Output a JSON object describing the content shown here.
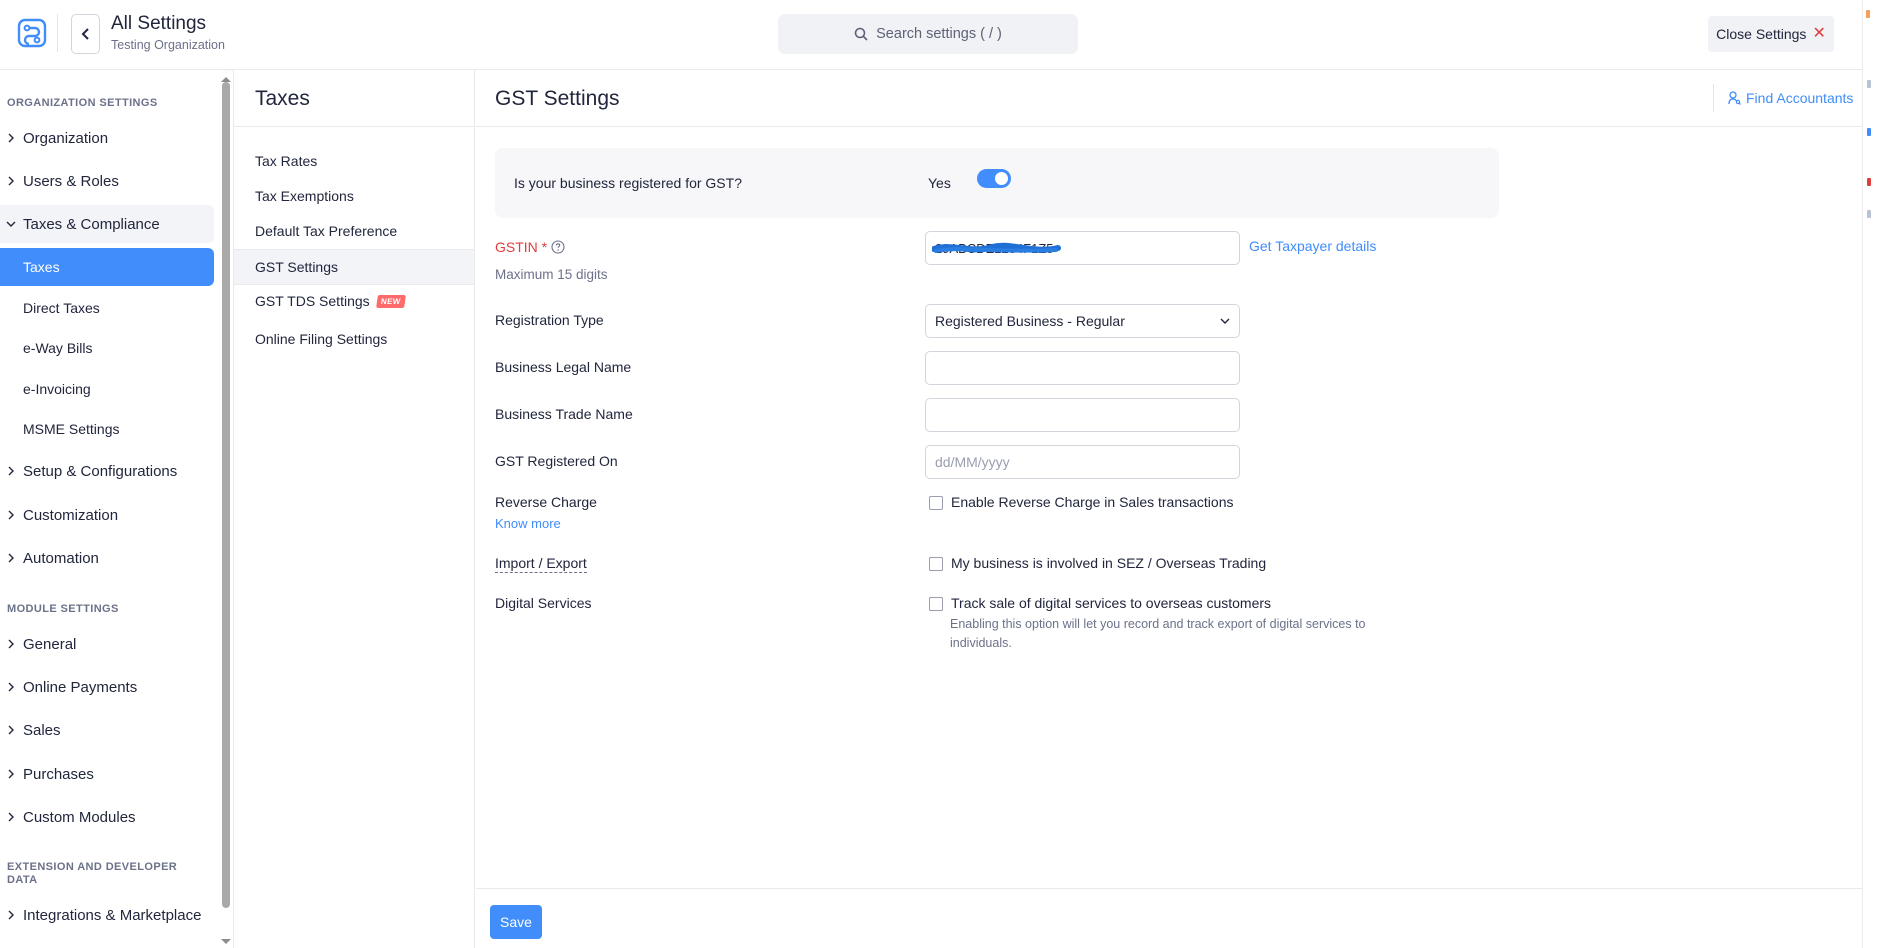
{
  "header": {
    "title": "All Settings",
    "subtitle": "Testing Organization",
    "search_placeholder": "Search settings ( / )",
    "close_label": "Close Settings"
  },
  "sidebar": {
    "org_heading": "ORGANIZATION SETTINGS",
    "org_items": [
      {
        "label": "Organization"
      },
      {
        "label": "Users & Roles"
      },
      {
        "label": "Taxes & Compliance"
      }
    ],
    "tax_subitems": [
      {
        "label": "Taxes"
      },
      {
        "label": "Direct Taxes"
      },
      {
        "label": "e-Way Bills"
      },
      {
        "label": "e-Invoicing"
      },
      {
        "label": "MSME Settings"
      }
    ],
    "org_items_after": [
      {
        "label": "Setup & Configurations"
      },
      {
        "label": "Customization"
      },
      {
        "label": "Automation"
      }
    ],
    "module_heading": "MODULE SETTINGS",
    "module_items": [
      {
        "label": "General"
      },
      {
        "label": "Online Payments"
      },
      {
        "label": "Sales"
      },
      {
        "label": "Purchases"
      },
      {
        "label": "Custom Modules"
      }
    ],
    "ext_heading": "EXTENSION AND DEVELOPER DATA",
    "ext_items": [
      {
        "label": "Integrations & Marketplace"
      }
    ]
  },
  "midnav": {
    "title": "Taxes",
    "items": [
      {
        "label": "Tax Rates"
      },
      {
        "label": "Tax Exemptions"
      },
      {
        "label": "Default Tax Preference"
      },
      {
        "label": "GST Settings"
      },
      {
        "label": "GST TDS Settings"
      },
      {
        "label": "Online Filing Settings"
      }
    ],
    "new_badge": "NEW"
  },
  "main": {
    "title": "GST Settings",
    "find_accountants": "Find Accountants",
    "gst_question": "Is your business registered for GST?",
    "gst_answer": "Yes",
    "gstin_label": "GSTIN *",
    "gstin_value": "29ABCDE1234F1Z5",
    "gstin_hint": "Maximum 15 digits",
    "get_taxpayer": "Get Taxpayer details",
    "reg_type_label": "Registration Type",
    "reg_type_value": "Registered Business - Regular",
    "legal_name_label": "Business Legal Name",
    "legal_name_value": "",
    "trade_name_label": "Business Trade Name",
    "trade_name_value": "",
    "reg_on_label": "GST Registered On",
    "reg_on_placeholder": "dd/MM/yyyy",
    "reverse_label": "Reverse Charge",
    "reverse_know_more": "Know more",
    "reverse_option": "Enable Reverse Charge in Sales transactions",
    "import_label": "Import / Export",
    "import_option": "My business is involved in SEZ / Overseas Trading",
    "digital_label": "Digital Services",
    "digital_option": "Track sale of digital services to overseas customers",
    "digital_desc": "Enabling this option will let you record and track export of digital services to individuals."
  },
  "footer": {
    "save_label": "Save"
  },
  "colors": {
    "accent": "#408dfb",
    "danger": "#e03d3d"
  }
}
